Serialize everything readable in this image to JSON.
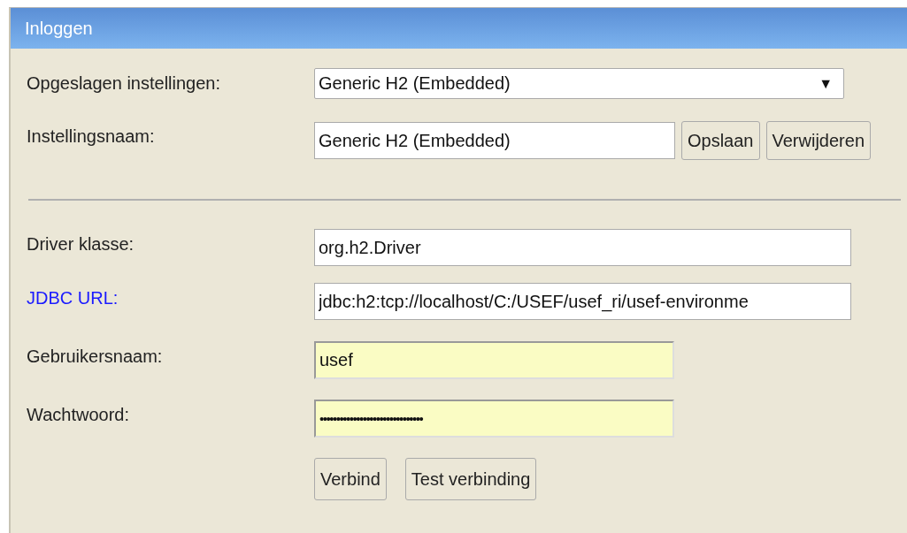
{
  "window": {
    "title": "Inloggen"
  },
  "settings": [
    {
      "kind": "select",
      "label": "Opgeslagen instellingen:",
      "value": "Generic H2 (Embedded)",
      "caret": "▼"
    },
    {
      "kind": "text",
      "label": "Instellingsnaam:",
      "value": "Generic H2 (Embedded)",
      "buttons": [
        "Opslaan",
        "Verwijderen"
      ]
    }
  ],
  "fields": [
    {
      "kind": "text",
      "label": "Driver klasse:",
      "label_link": false,
      "value": "org.h2.Driver",
      "autofilled": false,
      "wide": true
    },
    {
      "kind": "text",
      "label": "JDBC URL:",
      "label_link": true,
      "value": "jdbc:h2:tcp://localhost/C:/USEF/usef_ri/usef-environme",
      "autofilled": false,
      "wide": true
    },
    {
      "kind": "text",
      "label": "Gebruikersnaam:",
      "label_link": false,
      "value": "usef",
      "autofilled": true,
      "wide": false
    },
    {
      "kind": "password",
      "label": "Wachtwoord:",
      "label_link": false,
      "value": "•••••••••••••••••••••••••••••••",
      "autofilled": true,
      "wide": false
    }
  ],
  "buttons": [
    "Verbind",
    "Test verbinding"
  ]
}
